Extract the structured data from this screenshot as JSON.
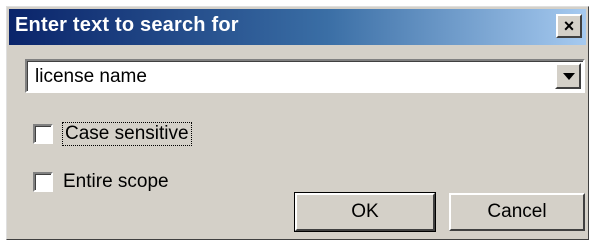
{
  "dialog": {
    "title": "Enter text to search for",
    "close_label": "×",
    "search_combo": {
      "value": "license name"
    },
    "options": [
      {
        "label": "Case sensitive",
        "checked": false
      },
      {
        "label": "Entire scope",
        "checked": false
      }
    ],
    "buttons": {
      "ok": "OK",
      "cancel": "Cancel"
    }
  },
  "colors": {
    "title_gradient_start": "#0a246a",
    "title_gradient_end": "#a6caf0",
    "face": "#d4d0c8"
  }
}
